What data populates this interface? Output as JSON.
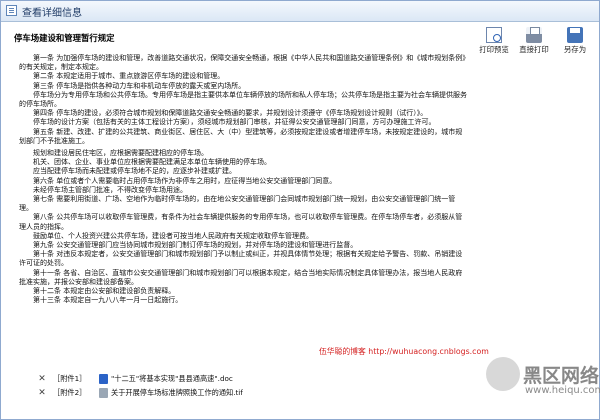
{
  "window": {
    "title": "查看详细信息"
  },
  "toolbar": {
    "print_preview": "打印预览",
    "direct_print": "直接打印",
    "save_as": "另存为"
  },
  "document": {
    "title": "停车场建设和管理暂行规定",
    "paragraphs": [
      "第一条 为加强停车场的建设和管理，改善道路交通状况，保障交通安全畅通，根据《中华人民共和国道路交通管理条例》和《城市规划条例》的有关规定，制定本规定。",
      "第二条 本规定适用于城市、重点旅游区停车场的建设和管理。",
      "第三条 停车场是指供各种动力车和非机动车停放的露天或室内场所。",
      "停车场分为专用停车场和公共停车场。专用停车场是指主要供本单位车辆停放的场所和私人停车场；公共停车场是指主要为社会车辆提供服务的停车场所。",
      "第四条 停车场的建设，必须符合城市规划和保障道路交通安全畅通的要求，并规划设计须遵守《停车场规划设计规则（试行）》。",
      "停车场的设计方案（包括有关的主体工程设计方案），须经城市规划部门审核，并征得公安交通管理部门同意，方可办理施工许可。",
      "第五条 新建、改建、扩建的公共建筑、商业街区、居住区、大（中）型建筑等，必须按规定建设或者增建停车场，未按规定建设的，城市规划部门不予批准施工。",
      "规划和建设居民住宅区，应根据需要配建相应的停车场。",
      "机关、团体、企业、事业单位应根据需要配建满足本单位车辆使用的停车场。",
      "应当配建停车场而未配建或停车场地不足的，应逐步补建或扩建。",
      "第六条 单位或者个人需要临时占用停车场作为非停车之用时，应征得当地公安交通管理部门同意。",
      "未经停车场主管部门批准，不得改变停车场用途。",
      "第七条 需要利用街道、广场、空地作为临时停车场的，由在地公安交通管理部门会同城市规划部门统一规划，由公安交通管理部门统一管理。",
      "第八条 公共停车场可以收取停车管理费，有条件为社会车辆提供服务的专用停车场，也可以收取停车管理费。在停车场停车者，必须服从管理人员的指挥。",
      "鼓励单位、个人投资兴建公共停车场，建设者可按当地人民政府有关规定收取停车管理费。",
      "第九条 公安交通管理部门应当协同城市规划部门制订停车场的规划，并对停车场的建设和管理进行监督。",
      "第十条 对违反本规定者，公安交通管理部门和城市规划部门予以制止或纠正，并视具体情节处理；根据有关规定给予警告、罚款、吊销建设许可证的处罚。",
      "第十一条 各省、自治区、直辖市公安交通管理部门和城市规划部门可以根据本规定，结合当地实际情况制定具体管理办法，报当地人民政府批准实施，并报公安部和建设部备案。",
      "第十二条 本规定由公安部和建设部负责解释。",
      "第十三条 本规定自一九八八年一月一日起施行。"
    ]
  },
  "blog_link": "伍华聪的博客  http://wuhuacong.cnblogs.com",
  "attachments": [
    {
      "label": "［附件1］",
      "file": "\"十二五\"将基本实现\"县县通高速\".doc",
      "file_type": "doc"
    },
    {
      "label": "［附件2］",
      "file": "关于开展停车场标准牌照换工作的通知.tif",
      "file_type": "tif"
    }
  ],
  "watermark": {
    "main": "黑区网络",
    "sub": "www.heiqu.com"
  }
}
